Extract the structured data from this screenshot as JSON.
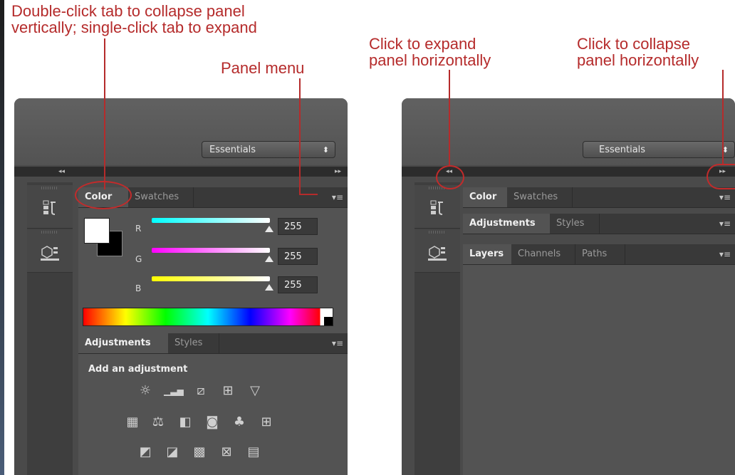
{
  "callouts": {
    "double_click_line1": "Double-click tab to collapse panel",
    "double_click_line2": "vertically; single-click tab to expand",
    "panel_menu": "Panel menu",
    "expand_line1": "Click to expand",
    "expand_line2": "panel horizontally",
    "collapse_line1": "Click to collapse",
    "collapse_line2": "panel horizontally"
  },
  "left_panel": {
    "workspace": "Essentials",
    "collapse_arrows": "◂◂",
    "expand_arrows": "▸▸",
    "color_group": {
      "tabs": [
        "Color",
        "Swatches"
      ],
      "sliders": [
        {
          "label": "R",
          "value": "255",
          "gradient": [
            "#00ffff",
            "#ffffff"
          ]
        },
        {
          "label": "G",
          "value": "255",
          "gradient": [
            "#ff00ff",
            "#ffffff"
          ]
        },
        {
          "label": "B",
          "value": "255",
          "gradient": [
            "#ffff00",
            "#ffffff"
          ]
        }
      ]
    },
    "adjustments_group": {
      "tabs": [
        "Adjustments",
        "Styles"
      ],
      "heading": "Add an adjustment",
      "icon_rows": [
        [
          "brightness-contrast-icon",
          "levels-icon",
          "curves-icon",
          "exposure-icon",
          "vibrance-icon"
        ],
        [
          "hue-saturation-icon",
          "color-balance-icon",
          "black-white-icon",
          "photo-filter-icon",
          "channel-mixer-icon",
          "color-lookup-icon"
        ],
        [
          "invert-icon",
          "posterize-icon",
          "threshold-icon",
          "selective-color-icon",
          "gradient-map-icon"
        ]
      ]
    }
  },
  "right_panel": {
    "workspace": "Essentials",
    "collapse_arrows": "◂◂",
    "expand_arrows": "▸▸",
    "groups": [
      {
        "tabs": [
          "Color",
          "Swatches"
        ]
      },
      {
        "tabs": [
          "Adjustments",
          "Styles"
        ]
      },
      {
        "tabs": [
          "Layers",
          "Channels",
          "Paths"
        ]
      }
    ]
  },
  "colors": {
    "callout_red": "#b52b2b",
    "panel_bg": "#535353",
    "tab_bar": "#393939"
  }
}
